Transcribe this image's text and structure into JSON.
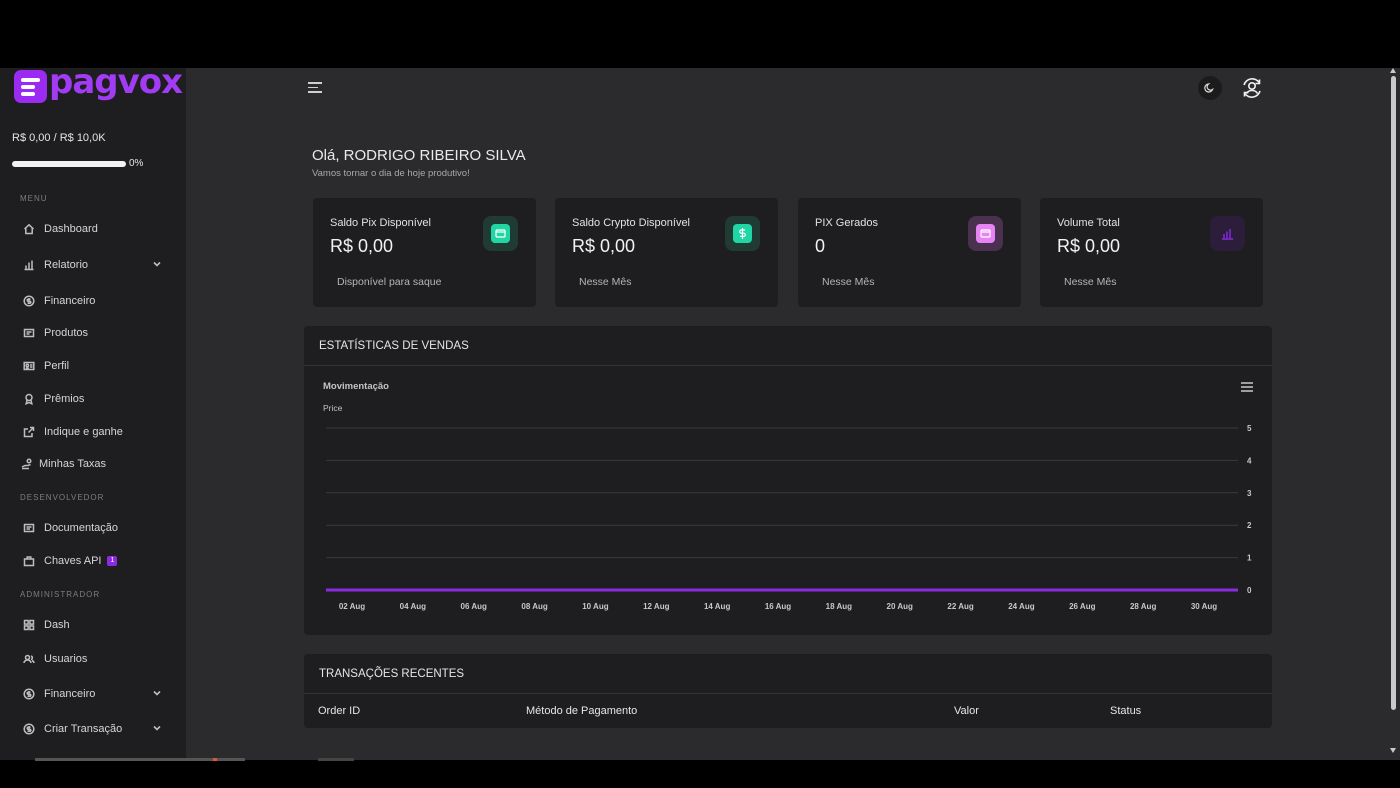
{
  "brand": {
    "name": "pagvox"
  },
  "limit": {
    "text": "R$ 0,00 / R$ 10,0K",
    "progress": 0,
    "percent_text": "0%"
  },
  "sidebar": {
    "sections": {
      "menu": "MENU",
      "dev": "DESENVOLVEDOR",
      "admin": "ADMINISTRADOR"
    },
    "items": [
      {
        "label": "Dashboard",
        "icon": "home-icon"
      },
      {
        "label": "Relatorio",
        "icon": "bar-chart-icon",
        "has_chevron": true
      },
      {
        "label": "Financeiro",
        "icon": "dollar-circle-icon"
      },
      {
        "label": "Produtos",
        "icon": "box-icon"
      },
      {
        "label": "Perfil",
        "icon": "id-card-icon"
      },
      {
        "label": "Prêmios",
        "icon": "award-icon"
      },
      {
        "label": "Indique e ganhe",
        "icon": "share-icon"
      },
      {
        "label": "Minhas Taxas",
        "icon": "hand-coin-icon"
      },
      {
        "label": "Documentação",
        "icon": "document-icon"
      },
      {
        "label": "Chaves API",
        "icon": "briefcase-icon",
        "badge": "1"
      },
      {
        "label": "Dash",
        "icon": "grid-icon"
      },
      {
        "label": "Usuarios",
        "icon": "users-icon"
      },
      {
        "label": "Financeiro",
        "icon": "dollar-circle-icon",
        "has_chevron": true
      },
      {
        "label": "Criar Transação",
        "icon": "dollar-circle-icon",
        "has_chevron": true
      }
    ]
  },
  "header": {
    "menu_icon": "hamburger-icon",
    "theme_icon": "moon-icon",
    "user_icon": "user-sync-icon"
  },
  "greeting": {
    "title": "Olá, RODRIGO RIBEIRO SILVA",
    "subtitle": "Vamos tornar o dia de hoje produtivo!"
  },
  "stats": [
    {
      "title": "Saldo Pix Disponível",
      "value": "R$ 0,00",
      "note": "Disponível para saque",
      "icon": "wallet-icon",
      "color": "#1fd6a4",
      "bg": "#1f3b33"
    },
    {
      "title": "Saldo Crypto Disponível",
      "value": "R$ 0,00",
      "note": "Nesse Mês",
      "icon": "dollar-icon",
      "color": "#1fd6a4",
      "bg": "#1f3b33"
    },
    {
      "title": "PIX Gerados",
      "value": "0",
      "note": "Nesse Mês",
      "icon": "wallet-icon",
      "color": "#e684f4",
      "bg": "#4a3150"
    },
    {
      "title": "Volume Total",
      "value": "R$ 0,00",
      "note": "Nesse Mês",
      "icon": "bar-chart-icon",
      "color": "#8a2be2",
      "bg": "#2c1d3b"
    }
  ],
  "sales_card": {
    "title": "ESTATÍSTICAS DE VENDAS",
    "menu_icon": "chart-menu-icon"
  },
  "chart_data": {
    "type": "line",
    "title": "Movimentação",
    "ylabel": "Price",
    "xlabel": "",
    "x_ticks": [
      "02 Aug",
      "04 Aug",
      "06 Aug",
      "08 Aug",
      "10 Aug",
      "12 Aug",
      "14 Aug",
      "16 Aug",
      "18 Aug",
      "20 Aug",
      "22 Aug",
      "24 Aug",
      "26 Aug",
      "28 Aug",
      "30 Aug"
    ],
    "y_ticks": [
      0,
      1,
      2,
      3,
      4,
      5
    ],
    "ylim": [
      0,
      5
    ],
    "y_axis_side": "right",
    "grid": true,
    "series": [
      {
        "values": [
          0,
          0,
          0,
          0,
          0,
          0,
          0,
          0,
          0,
          0,
          0,
          0,
          0,
          0,
          0
        ],
        "color": "#8a2be2"
      }
    ]
  },
  "transactions": {
    "title": "TRANSAÇÕES RECENTES",
    "columns": [
      "Order ID",
      "Método de Pagamento",
      "Valor",
      "Status"
    ]
  }
}
